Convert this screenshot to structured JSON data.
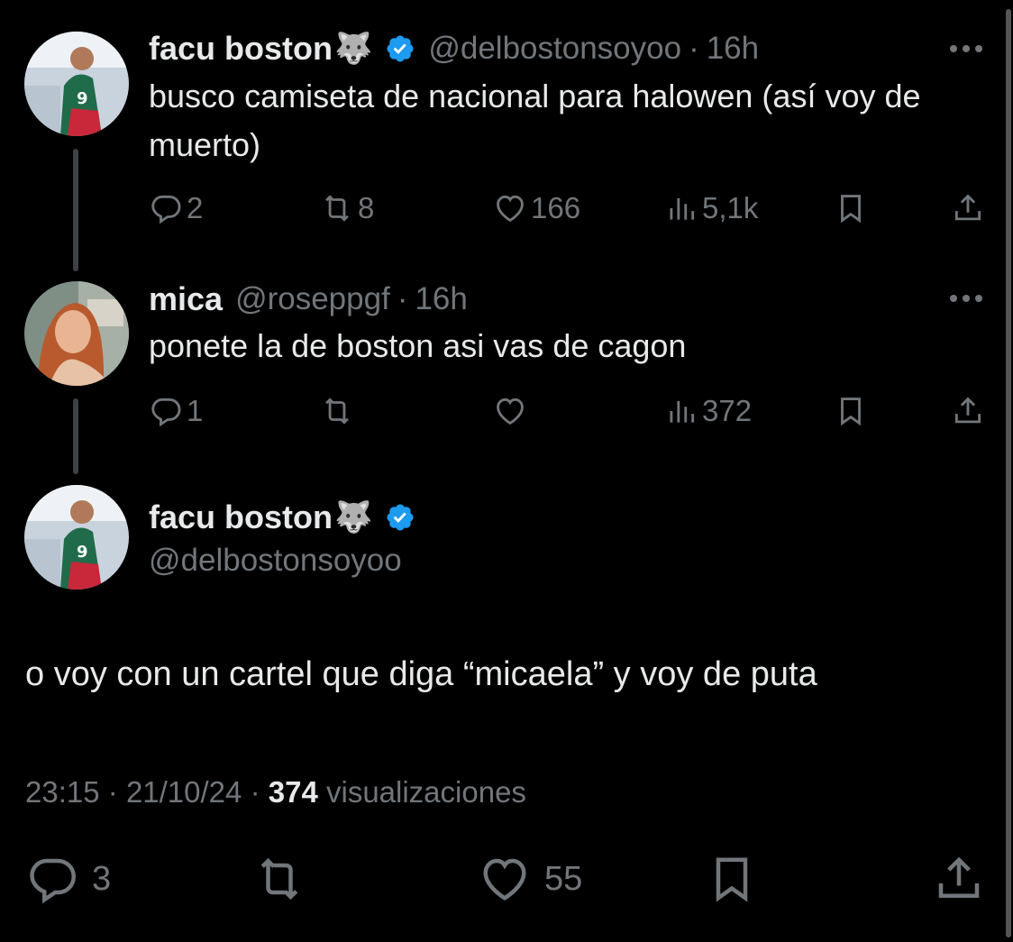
{
  "tweets": [
    {
      "name": "facu boston",
      "emoji": "🐺",
      "handle": "@delbostonsoyoo",
      "dot": "·",
      "time": "16h",
      "text": "busco camiseta de nacional para halowen (así voy de muerto)",
      "replies": "2",
      "retweets": "8",
      "likes": "166",
      "views": "5,1k"
    },
    {
      "name": "mica",
      "handle": "@roseppgf",
      "dot": "·",
      "time": "16h",
      "text": "ponete la de boston asi vas de cagon",
      "replies": "1",
      "retweets": "",
      "likes": "",
      "views": "372"
    }
  ],
  "main": {
    "name": "facu boston",
    "emoji": "🐺",
    "handle": "@delbostonsoyoo",
    "text": "o voy con un cartel que diga “micaela” y voy de puta",
    "time": "23:15",
    "sep1": "·",
    "date": "21/10/24",
    "sep2": "·",
    "views": "374",
    "views_label": "visualizaciones",
    "replies": "3",
    "likes": "55"
  },
  "colors": {
    "background": "#000000",
    "text": "#e7e9ea",
    "muted": "#71767b",
    "verified": "#1d9bf0"
  },
  "icons": [
    "reply-icon",
    "retweet-icon",
    "like-icon",
    "views-icon",
    "bookmark-icon",
    "share-icon",
    "verified-icon",
    "more-icon"
  ]
}
